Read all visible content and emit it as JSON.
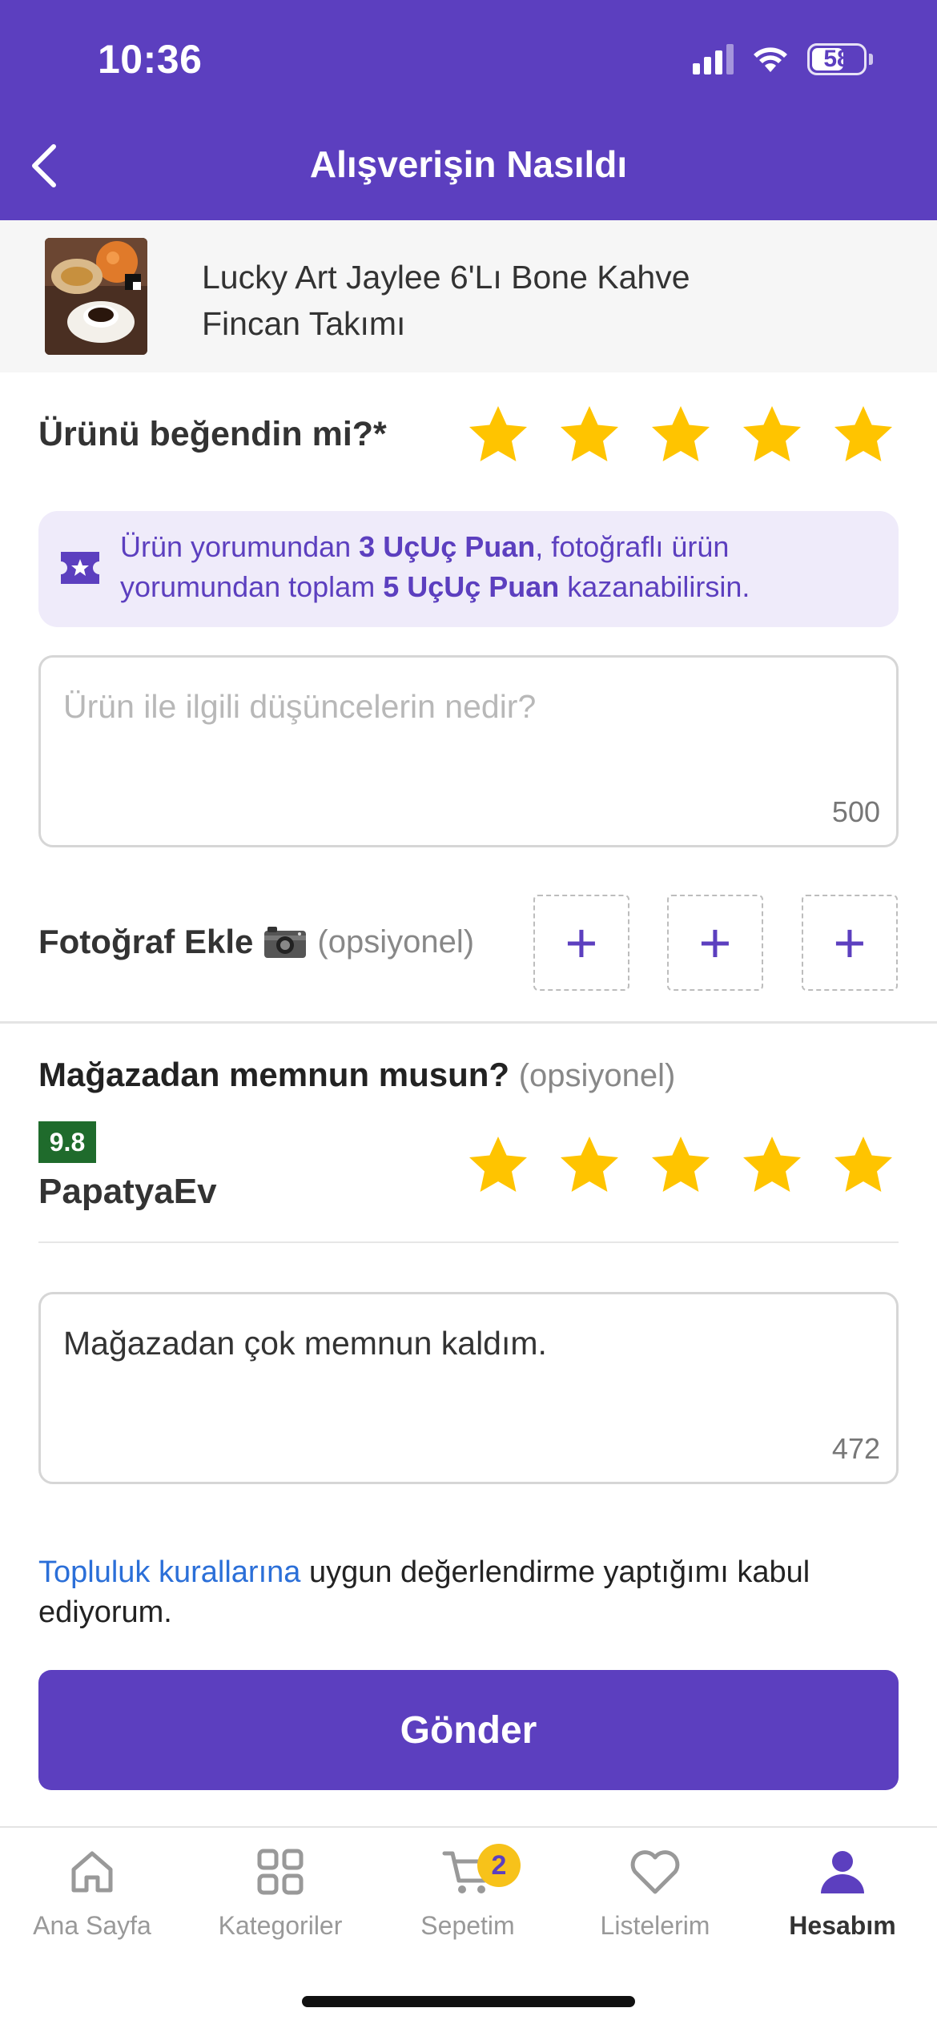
{
  "status_bar": {
    "time": "10:36",
    "battery": "58"
  },
  "header": {
    "title": "Alışverişin Nasıldı"
  },
  "product": {
    "name": "Lucky Art Jaylee 6'Lı Bone Kahve Fincan Takımı"
  },
  "product_rating": {
    "label": "Ürünü beğendin mi?*",
    "stars": 5,
    "max_stars": 5
  },
  "info": {
    "part1": "Ürün yorumundan ",
    "bold1": "3 UçUç Puan",
    "part2": ", fotoğraflı ürün yorumundan toplam ",
    "bold2": "5 UçUç Puan",
    "part3": " kazanabilirsin."
  },
  "review": {
    "placeholder": "Ürün ile ilgili düşüncelerin nedir?",
    "counter": "500"
  },
  "photo": {
    "label": "Fotoğraf Ekle",
    "optional": "(opsiyonel)"
  },
  "store": {
    "question": "Mağazadan memnun musun?",
    "optional": "(opsiyonel)",
    "score": "9.8",
    "name": "PapatyaEv",
    "stars": 5,
    "comment": "Mağazadan çok memnun kaldım.",
    "counter": "472"
  },
  "agreement": {
    "link": "Topluluk kurallarına",
    "text": " uygun değerlendirme yaptığımı kabul ediyorum."
  },
  "submit": {
    "label": "Gönder"
  },
  "tabs": [
    {
      "label": "Ana Sayfa",
      "icon": "home-icon"
    },
    {
      "label": "Kategoriler",
      "icon": "grid-icon"
    },
    {
      "label": "Sepetim",
      "icon": "cart-icon",
      "badge": "2"
    },
    {
      "label": "Listelerim",
      "icon": "heart-icon"
    },
    {
      "label": "Hesabım",
      "icon": "user-icon",
      "active": true
    }
  ],
  "colors": {
    "primary": "#5c3fbf",
    "star": "#ffc400",
    "badge": "#f7c21a",
    "score": "#1f6b2c",
    "link": "#2b6fd8"
  }
}
